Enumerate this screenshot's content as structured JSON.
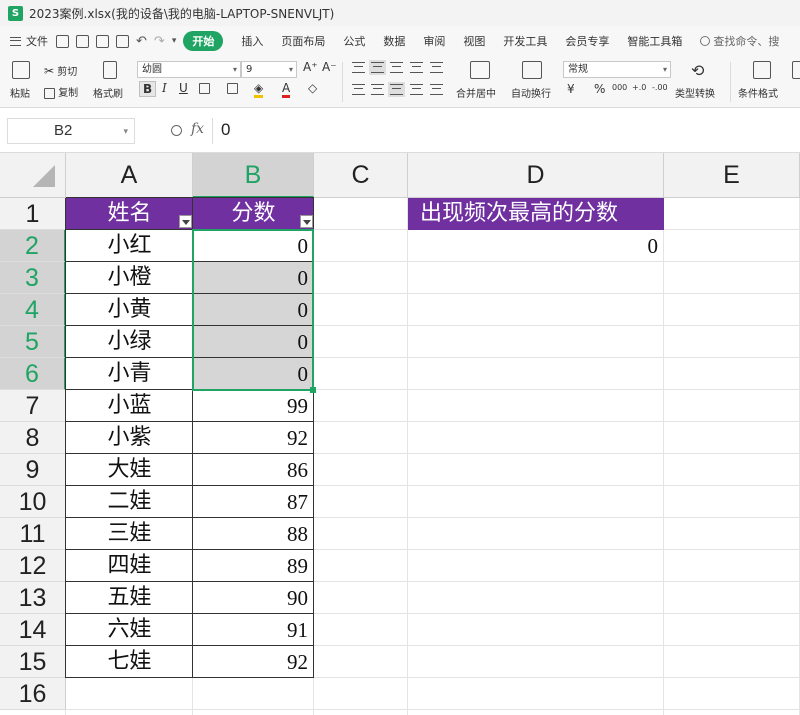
{
  "window": {
    "title": "2023案例.xlsx(我的设备\\我的电脑-LAPTOP-SNENVLJT)",
    "logo": "S"
  },
  "menu": {
    "file_label": "文件",
    "tabs": [
      "开始",
      "插入",
      "页面布局",
      "公式",
      "数据",
      "审阅",
      "视图",
      "开发工具",
      "会员专享",
      "智能工具箱"
    ],
    "active_tab": "开始",
    "search_label": "查找命令、搜"
  },
  "ribbon": {
    "paste": "粘贴",
    "cut": "剪切",
    "copy": "复制",
    "format_painter": "格式刷",
    "font_name": "幼圆",
    "font_size": "9",
    "grow_font": "A⁺",
    "shrink_font": "A⁻",
    "bold": "B",
    "italic": "I",
    "underline": "U",
    "merge_center": "合并居中",
    "wrap_text": "自动换行",
    "number_format": "常规",
    "currency": "¥",
    "percent": "%",
    "thousands": "000",
    "inc_decimal": "+.0",
    "dec_decimal": "-.00",
    "type_convert": "类型转换",
    "conditional_format": "条件格式"
  },
  "formula_bar": {
    "cell_ref": "B2",
    "fx": "fx",
    "value": "0"
  },
  "grid": {
    "columns": [
      "A",
      "B",
      "C",
      "D",
      "E"
    ],
    "selected_column": "B",
    "rows": [
      "1",
      "2",
      "3",
      "4",
      "5",
      "6",
      "7",
      "8",
      "9",
      "10",
      "11",
      "12",
      "13",
      "14",
      "15",
      "16"
    ],
    "selected_rows": [
      "2",
      "3",
      "4",
      "5",
      "6"
    ],
    "header_row": {
      "A": "姓名",
      "B": "分数",
      "D": "出现频次最高的分数"
    },
    "data_rows": [
      {
        "name": "小红",
        "score": "0"
      },
      {
        "name": "小橙",
        "score": "0"
      },
      {
        "name": "小黄",
        "score": "0"
      },
      {
        "name": "小绿",
        "score": "0"
      },
      {
        "name": "小青",
        "score": "0"
      },
      {
        "name": "小蓝",
        "score": "99"
      },
      {
        "name": "小紫",
        "score": "92"
      },
      {
        "name": "大娃",
        "score": "86"
      },
      {
        "name": "二娃",
        "score": "87"
      },
      {
        "name": "三娃",
        "score": "88"
      },
      {
        "name": "四娃",
        "score": "89"
      },
      {
        "name": "五娃",
        "score": "90"
      },
      {
        "name": "六娃",
        "score": "91"
      },
      {
        "name": "七娃",
        "score": "92"
      }
    ],
    "d2_value": "0"
  },
  "colors": {
    "accent_green": "#1fa463",
    "header_purple": "#7030a0",
    "selection_fill": "#d6d6d6"
  }
}
